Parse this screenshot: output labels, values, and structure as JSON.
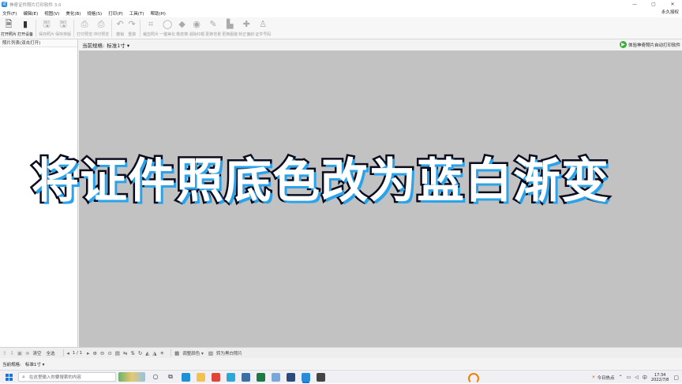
{
  "window": {
    "title": "神奇证件照片打印软件 3.0",
    "icon_letter": "证",
    "controls": [
      "—",
      "▢",
      "✕"
    ]
  },
  "menu": {
    "items": [
      "文件(F)",
      "编辑(E)",
      "视图(V)",
      "美化(B)",
      "规格(S)",
      "打印(P)",
      "工具(T)",
      "帮助(H)"
    ],
    "right_label": "永久授权"
  },
  "toolbar": {
    "tools": [
      {
        "label": "打开照片",
        "icon": "open-photo-icon",
        "glyph": "🗎",
        "enabled": true
      },
      {
        "label": "打开设备",
        "icon": "device-icon",
        "glyph": "▮",
        "enabled": true
      },
      {
        "label": "保存照片",
        "icon": "save-photo-icon",
        "glyph": "🖫",
        "enabled": false
      },
      {
        "label": "保存排版",
        "icon": "save-layout-icon",
        "glyph": "🖫",
        "enabled": false
      },
      {
        "label": "打印预览",
        "icon": "print-preview-icon",
        "glyph": "⎙",
        "enabled": false
      },
      {
        "label": "冲印预览",
        "icon": "photo-print-icon",
        "glyph": "⎙",
        "enabled": false
      },
      {
        "label": "撤销",
        "icon": "undo-icon",
        "glyph": "↶",
        "enabled": false
      },
      {
        "label": "重做",
        "icon": "redo-icon",
        "glyph": "↷",
        "enabled": false
      },
      {
        "label": "裁剪照片",
        "icon": "crop-icon",
        "glyph": "⌗",
        "enabled": false
      },
      {
        "label": "一键美化",
        "icon": "beautify-icon",
        "glyph": "◯",
        "enabled": false
      },
      {
        "label": "橡皮擦",
        "icon": "eraser-icon",
        "glyph": "◆",
        "enabled": false
      },
      {
        "label": "消除红眼",
        "icon": "redeye-icon",
        "glyph": "◉",
        "enabled": false
      },
      {
        "label": "更换背景",
        "icon": "change-bg-icon",
        "glyph": "✎",
        "enabled": false
      },
      {
        "label": "更换服装",
        "icon": "change-clothes-icon",
        "glyph": "▙",
        "enabled": false
      },
      {
        "label": "矫正偏斜",
        "icon": "correct-tilt-icon",
        "glyph": "✚",
        "enabled": false
      },
      {
        "label": "证件号码",
        "icon": "id-number-icon",
        "glyph": "♙",
        "enabled": false
      }
    ]
  },
  "left_panel": {
    "header": "照片列表(双击打开)"
  },
  "spec_header": {
    "label": "当前规格:",
    "value": "标准1寸 ▾",
    "promo_icon": "▶",
    "promo_text": "体验神奇照片自动打印软件"
  },
  "overlay": {
    "caption": "将证件照底色改为蓝白渐变"
  },
  "bottom_toolbar": {
    "clear_label": "清空",
    "select_all_label": "全选",
    "page_indicator": "1 / 1",
    "color_adjust_label": "调整颜色 ▾",
    "convert_label": "转为黑白照片"
  },
  "status": {
    "label": "当前规格:",
    "value": "标准1寸 ▾"
  },
  "taskbar": {
    "search_placeholder": "在这里输入你要搜索的内容",
    "weather_text": "今日热点",
    "date": "2022/7/8",
    "time": "17:34",
    "input_method": "中",
    "apps": [
      {
        "name": "edge-app",
        "color": "#1f8fd6"
      },
      {
        "name": "file-explorer-app",
        "color": "#f2c14e"
      },
      {
        "name": "chrome-app",
        "color": "#e0453a"
      },
      {
        "name": "edge-dev-app",
        "color": "#2da6d8"
      },
      {
        "name": "settings-app",
        "color": "#3a6ea5"
      },
      {
        "name": "excel-app",
        "color": "#1d7a45"
      },
      {
        "name": "notepad-app",
        "color": "#7aa7d6"
      },
      {
        "name": "photo-app",
        "color": "#2a4b7c"
      },
      {
        "name": "id-photo-app",
        "color": "#2a8bd8"
      },
      {
        "name": "media-app",
        "color": "#444444"
      }
    ]
  }
}
